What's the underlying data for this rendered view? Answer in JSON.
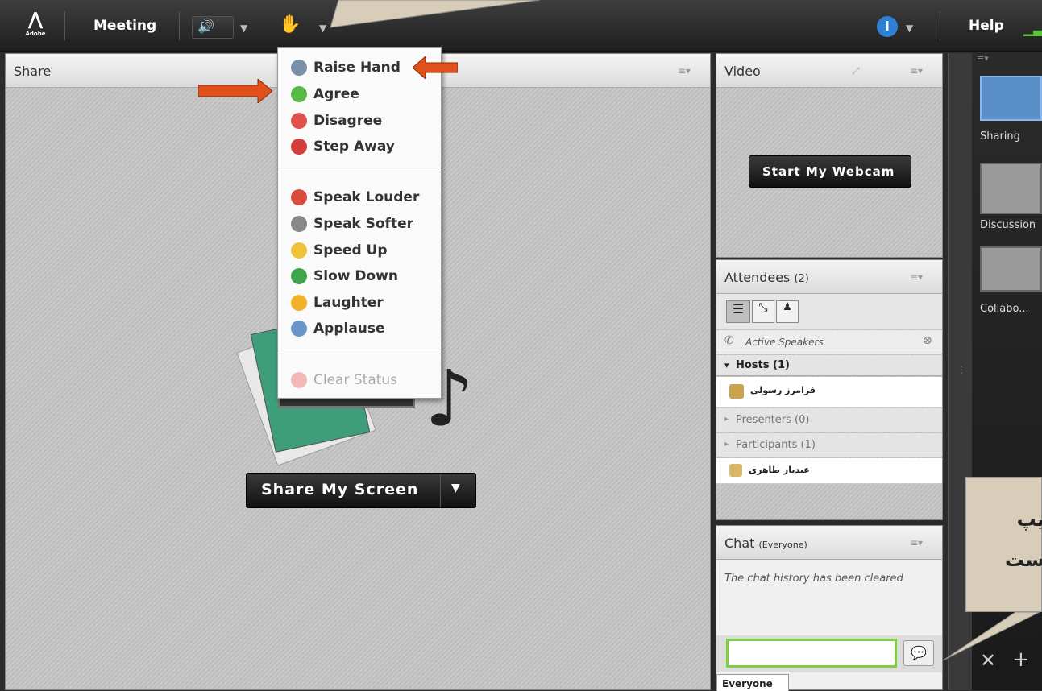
{
  "topbar": {
    "meeting": "Meeting",
    "help": "Help",
    "logo": "Adobe"
  },
  "menu": {
    "items": [
      {
        "label": "Raise Hand",
        "icon": "raise-hand-icon",
        "color": "#7a8fa8"
      },
      {
        "label": "Agree",
        "icon": "agree-icon",
        "color": "#58b947"
      },
      {
        "label": "Disagree",
        "icon": "disagree-icon",
        "color": "#e0504d"
      },
      {
        "label": "Step Away",
        "icon": "step-away-icon",
        "color": "#d33d3d"
      },
      {
        "label": "Speak Louder",
        "icon": "speak-louder-icon",
        "color": "#d94c3c"
      },
      {
        "label": "Speak Softer",
        "icon": "speak-softer-icon",
        "color": "#888888"
      },
      {
        "label": "Speed Up",
        "icon": "speed-up-icon",
        "color": "#f0c23a"
      },
      {
        "label": "Slow Down",
        "icon": "slow-down-icon",
        "color": "#3fa54a"
      },
      {
        "label": "Laughter",
        "icon": "laughter-icon",
        "color": "#f2b228"
      },
      {
        "label": "Applause",
        "icon": "applause-icon",
        "color": "#6a95c8"
      }
    ],
    "clear": "Clear Status"
  },
  "share": {
    "title": "Share",
    "button": "Share My Screen"
  },
  "video": {
    "title": "Video",
    "button": "Start My Webcam"
  },
  "attendees": {
    "title": "Attendees",
    "count": "(2)",
    "active": "Active Speakers",
    "hosts": "Hosts (1)",
    "host_name": "فرامرز رسولی",
    "presenters": "Presenters (0)",
    "participants": "Participants (1)",
    "participant_name": "عبدیار طاهری"
  },
  "chat": {
    "title": "Chat",
    "scope": "(Everyone)",
    "history": "The chat history has been cleared",
    "tab": "Everyone"
  },
  "layouts": {
    "items": [
      "Sharing",
      "Discussion",
      "Collabo..."
    ]
  },
  "callout": {
    "line1": "یپ",
    "line2": "ست"
  }
}
